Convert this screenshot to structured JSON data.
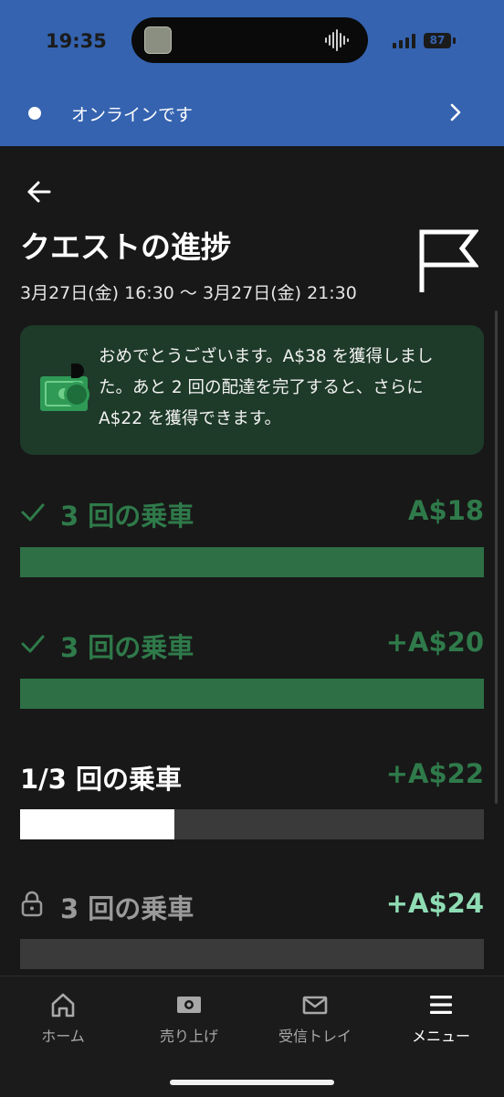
{
  "status_bar": {
    "time": "19:35",
    "battery": "87"
  },
  "banner": {
    "text": "オンラインです"
  },
  "header": {
    "title": "クエストの進捗",
    "date_range": "3月27日(金) 16:30 〜 3月27日(金) 21:30"
  },
  "congrats": {
    "text": "おめでとうございます。A$38 を獲得しました。あと 2 回の配達を完了すると、さらに A$22 を獲得できます。"
  },
  "quests": [
    {
      "label": "3 回の乗車",
      "amount": "A$18",
      "status": "completed",
      "progress": 1.0
    },
    {
      "label": "3 回の乗車",
      "amount": "+A$20",
      "status": "completed",
      "progress": 1.0
    },
    {
      "label": "1/3 回の乗車",
      "amount": "+A$22",
      "status": "in_progress",
      "progress": 0.333
    },
    {
      "label": "3 回の乗車",
      "amount": "+A$24",
      "status": "locked",
      "progress": 0.0
    }
  ],
  "tabs": [
    {
      "label": "ホーム",
      "icon": "home-icon"
    },
    {
      "label": "売り上げ",
      "icon": "earnings-icon"
    },
    {
      "label": "受信トレイ",
      "icon": "mail-icon"
    },
    {
      "label": "メニュー",
      "icon": "menu-icon",
      "active": true
    }
  ],
  "colors": {
    "banner_blue": "#3563b0",
    "green_bar": "#2e6f45",
    "green_text": "#2f7a4a",
    "mint_text": "#8fdcb4",
    "card_bg": "#1e3a29"
  }
}
